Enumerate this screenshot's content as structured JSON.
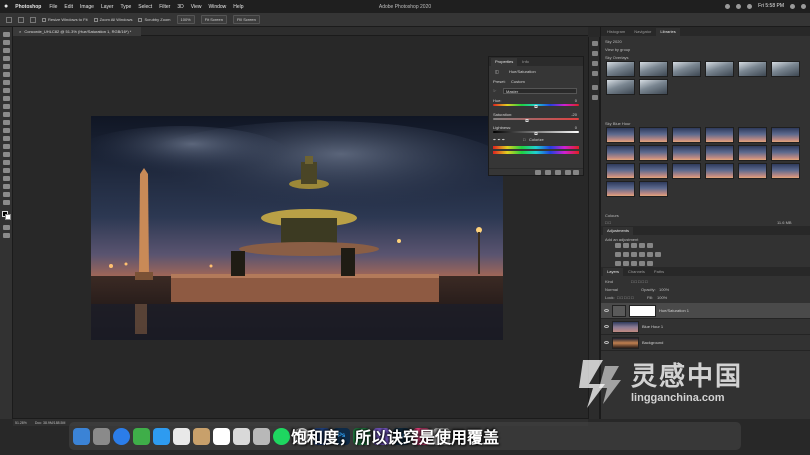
{
  "menubar": {
    "app": "Photoshop",
    "items": [
      "File",
      "Edit",
      "Image",
      "Layer",
      "Type",
      "Select",
      "Filter",
      "3D",
      "View",
      "Window",
      "Help"
    ],
    "window_title": "Adobe Photoshop 2020",
    "clock": "Fri 5:58 PM"
  },
  "options": {
    "resize_windows": "Resize Windows to Fit",
    "zoom_all": "Zoom All Windows",
    "scrubby_zoom": "Scrubby Zoom",
    "percent_btn": "100%",
    "fit_screen": "Fit Screen",
    "fill_screen": "Fill Screen"
  },
  "document": {
    "tab_label": "Concorde_UHLC82 @ 51.3% (Hue/Saturation 1, RGB/16*) *",
    "zoom": "51.28%",
    "doc_info": "Doc: 38.9M/188.5M"
  },
  "properties": {
    "tabs": [
      "Properties",
      "Info"
    ],
    "adjustment_title": "Hue/Saturation",
    "preset_label": "Preset:",
    "preset_value": "Custom",
    "channel_value": "Master",
    "hue_label": "Hue:",
    "hue_value": "0",
    "hue_pos": 0.5,
    "saturation_label": "Saturation:",
    "saturation_value": "-20",
    "saturation_pos": 0.4,
    "lightness_label": "Lightness:",
    "lightness_value": "0",
    "lightness_pos": 0.5,
    "colorize_label": "Colorize"
  },
  "dock": {
    "top_tabs": [
      "Histogram",
      "Navigator",
      "Libraries"
    ],
    "library_name": "Sky 2020",
    "view_by": "View by group",
    "group1": "Sky Overlays",
    "group2": "Sky Blue Hour",
    "group3": "Colours",
    "lib_size": "11.6 MB",
    "adjustments_tab": "Adjustments",
    "add_adjustment": "Add an adjustment",
    "layers_tabs": [
      "Layers",
      "Channels",
      "Paths"
    ],
    "kind_label": "Kind",
    "blend_mode": "Normal",
    "opacity_label": "Opacity:",
    "opacity_value": "100%",
    "lock_label": "Lock:",
    "fill_label": "Fill:",
    "fill_value": "100%",
    "layers": [
      "Hue/Saturation 1",
      "Blue Hour 1",
      "Background"
    ]
  },
  "subtitle": "饱和度，所以诀窍是使用覆盖",
  "watermark": {
    "title": "灵感中国",
    "url": "lingganchina.com"
  },
  "mac_dock": {
    "ps": "Ps",
    "lr": "Lr",
    "excel": "X"
  }
}
